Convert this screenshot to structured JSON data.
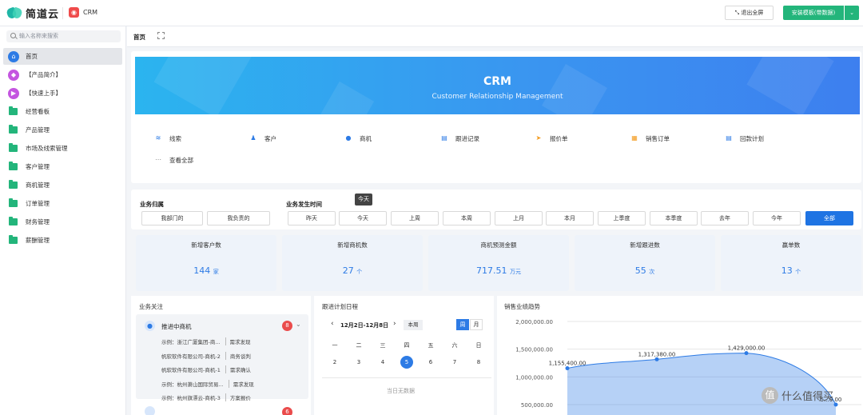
{
  "header": {
    "logo_text": "简道云",
    "app_name": "CRM",
    "exit_fullscreen": "退出全屏",
    "install_template": "安装模板(带数据)"
  },
  "sidebar": {
    "search_placeholder": "输入名称来搜索",
    "items": [
      {
        "label": "首页",
        "icon": "home-icon",
        "color": "#2d7be5"
      },
      {
        "label": "【产品简介】",
        "icon": "tag-icon",
        "color": "#c455e0"
      },
      {
        "label": "【快速上手】",
        "icon": "play-icon",
        "color": "#c455e0"
      },
      {
        "label": "经营看板",
        "icon": "folder-icon"
      },
      {
        "label": "产品管理",
        "icon": "folder-icon"
      },
      {
        "label": "市场及线索管理",
        "icon": "folder-icon"
      },
      {
        "label": "客户管理",
        "icon": "folder-icon"
      },
      {
        "label": "商机管理",
        "icon": "folder-icon"
      },
      {
        "label": "订单管理",
        "icon": "folder-icon"
      },
      {
        "label": "财务管理",
        "icon": "folder-icon"
      },
      {
        "label": "薪酬管理",
        "icon": "folder-icon"
      }
    ]
  },
  "tabs": {
    "home": "首页"
  },
  "banner": {
    "title": "CRM",
    "subtitle": "Customer Relationship Management"
  },
  "quick_links": [
    {
      "label": "线索",
      "icon": "clue-icon",
      "color": "#2d7be5"
    },
    {
      "label": "客户",
      "icon": "user-icon",
      "color": "#2d7be5"
    },
    {
      "label": "商机",
      "icon": "opportunity-icon",
      "color": "#2d7be5"
    },
    {
      "label": "跟进记录",
      "icon": "record-icon",
      "color": "#2d7be5"
    },
    {
      "label": "报价单",
      "icon": "send-icon",
      "color": "#f39a1d"
    },
    {
      "label": "销售订单",
      "icon": "order-icon",
      "color": "#f39a1d"
    },
    {
      "label": "回款计划",
      "icon": "plan-icon",
      "color": "#2d7be5"
    },
    {
      "label": "查看全部",
      "icon": "more-icon",
      "color": "#888"
    }
  ],
  "filters": {
    "ownership_label": "业务归属",
    "ownership": [
      "我部门的",
      "我负责的"
    ],
    "time_label": "业务发生时间",
    "time": [
      "昨天",
      "今天",
      "上周",
      "本周",
      "上月",
      "本月",
      "上季度",
      "本季度",
      "去年",
      "今年",
      "全部"
    ],
    "tooltip": "今天"
  },
  "stats": [
    {
      "label": "新增客户数",
      "value": "144",
      "unit": "家"
    },
    {
      "label": "新增商机数",
      "value": "27",
      "unit": "个"
    },
    {
      "label": "商机预测金额",
      "value": "717.51",
      "unit": "万元"
    },
    {
      "label": "新增跟进数",
      "value": "55",
      "unit": "次"
    },
    {
      "label": "赢单数",
      "value": "13",
      "unit": "个"
    }
  ],
  "focus": {
    "title": "业务关注",
    "group": "推进中商机",
    "badge": "8",
    "rows": [
      {
        "name": "示例：浙江广厦集团-商...",
        "stage": "需求发现"
      },
      {
        "name": "帆软软件有限公司-商机-2",
        "stage": "商务谈判"
      },
      {
        "name": "帆软软件有限公司-商机-1",
        "stage": "需求确认"
      },
      {
        "name": "示例：杭州萧山国际贸易...",
        "stage": "需求发现"
      },
      {
        "name": "示例：杭州旗漂云-商机-3",
        "stage": "方案报价"
      }
    ],
    "group2_badge": "6"
  },
  "calendar": {
    "title": "跟进计划日程",
    "range": "12月2日-12月8日",
    "this_week": "本周",
    "mode_week": "周",
    "mode_month": "月",
    "weekdays": [
      "一",
      "二",
      "三",
      "四",
      "五",
      "六",
      "日"
    ],
    "days": [
      "2",
      "3",
      "4",
      "5",
      "6",
      "7",
      "8"
    ],
    "today": "5",
    "empty": "当日无数据"
  },
  "chart_data": {
    "type": "area",
    "title": "销售业绩趋势",
    "y_ticks": [
      "2,000,000.00",
      "1,500,000.00",
      "1,000,000.00",
      "500,000.00"
    ],
    "ylim": [
      500000,
      2000000
    ],
    "points": [
      1155400,
      1317380,
      1429000,
      500000
    ],
    "labels": [
      "1,155,400.00",
      "1,317,380.00",
      "1,429,000.00",
      "5...0.00"
    ],
    "color": "#2d7be5"
  },
  "watermark": "值 什么值得买"
}
